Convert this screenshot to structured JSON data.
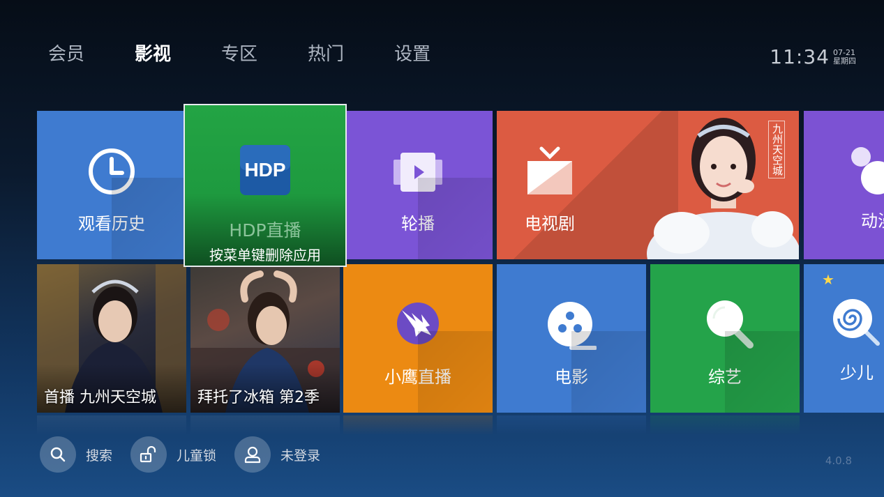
{
  "nav": {
    "items": [
      {
        "label": "会员",
        "active": false
      },
      {
        "label": "影视",
        "active": true
      },
      {
        "label": "专区",
        "active": false
      },
      {
        "label": "热门",
        "active": false
      },
      {
        "label": "设置",
        "active": false
      }
    ]
  },
  "clock": {
    "time": "11:34",
    "date": "07-21",
    "weekday": "星期四"
  },
  "tiles": {
    "history": {
      "label": "观看历史",
      "icon": "clock-icon",
      "color": "#3f7bd0"
    },
    "hdp": {
      "title": "HDP直播",
      "hint": "按菜单键删除应用",
      "logo": "HDP",
      "icon": "hdp-logo-icon",
      "color": "#23a444"
    },
    "lunbo": {
      "label": "轮播",
      "icon": "play-cards-icon",
      "color": "#7b54d6"
    },
    "tv": {
      "label": "电视剧",
      "poster_text": "九州天空城",
      "icon": "tv-icon",
      "color": "#dc5b42"
    },
    "anime": {
      "label": "动漫",
      "icon": "mickey-icon",
      "color": "#7c52d3"
    },
    "poster1": {
      "caption": "首播 九州天空城"
    },
    "poster2": {
      "caption": "拜托了冰箱 第2季"
    },
    "eagle": {
      "label": "小鹰直播",
      "icon": "eagle-icon",
      "color": "#ec8a12"
    },
    "movie": {
      "label": "电影",
      "icon": "film-reel-icon",
      "color": "#3f7bd0"
    },
    "variety": {
      "label": "综艺",
      "icon": "microphone-icon",
      "color": "#24a34a"
    },
    "kids": {
      "label": "少儿",
      "icon": "lollipop-icon",
      "color": "#3f7bd0"
    }
  },
  "bottom": {
    "search": {
      "label": "搜索",
      "icon": "search-icon"
    },
    "childlock": {
      "label": "儿童锁",
      "icon": "unlock-icon"
    },
    "login": {
      "label": "未登录",
      "icon": "user-icon"
    }
  },
  "version": "4.0.8"
}
